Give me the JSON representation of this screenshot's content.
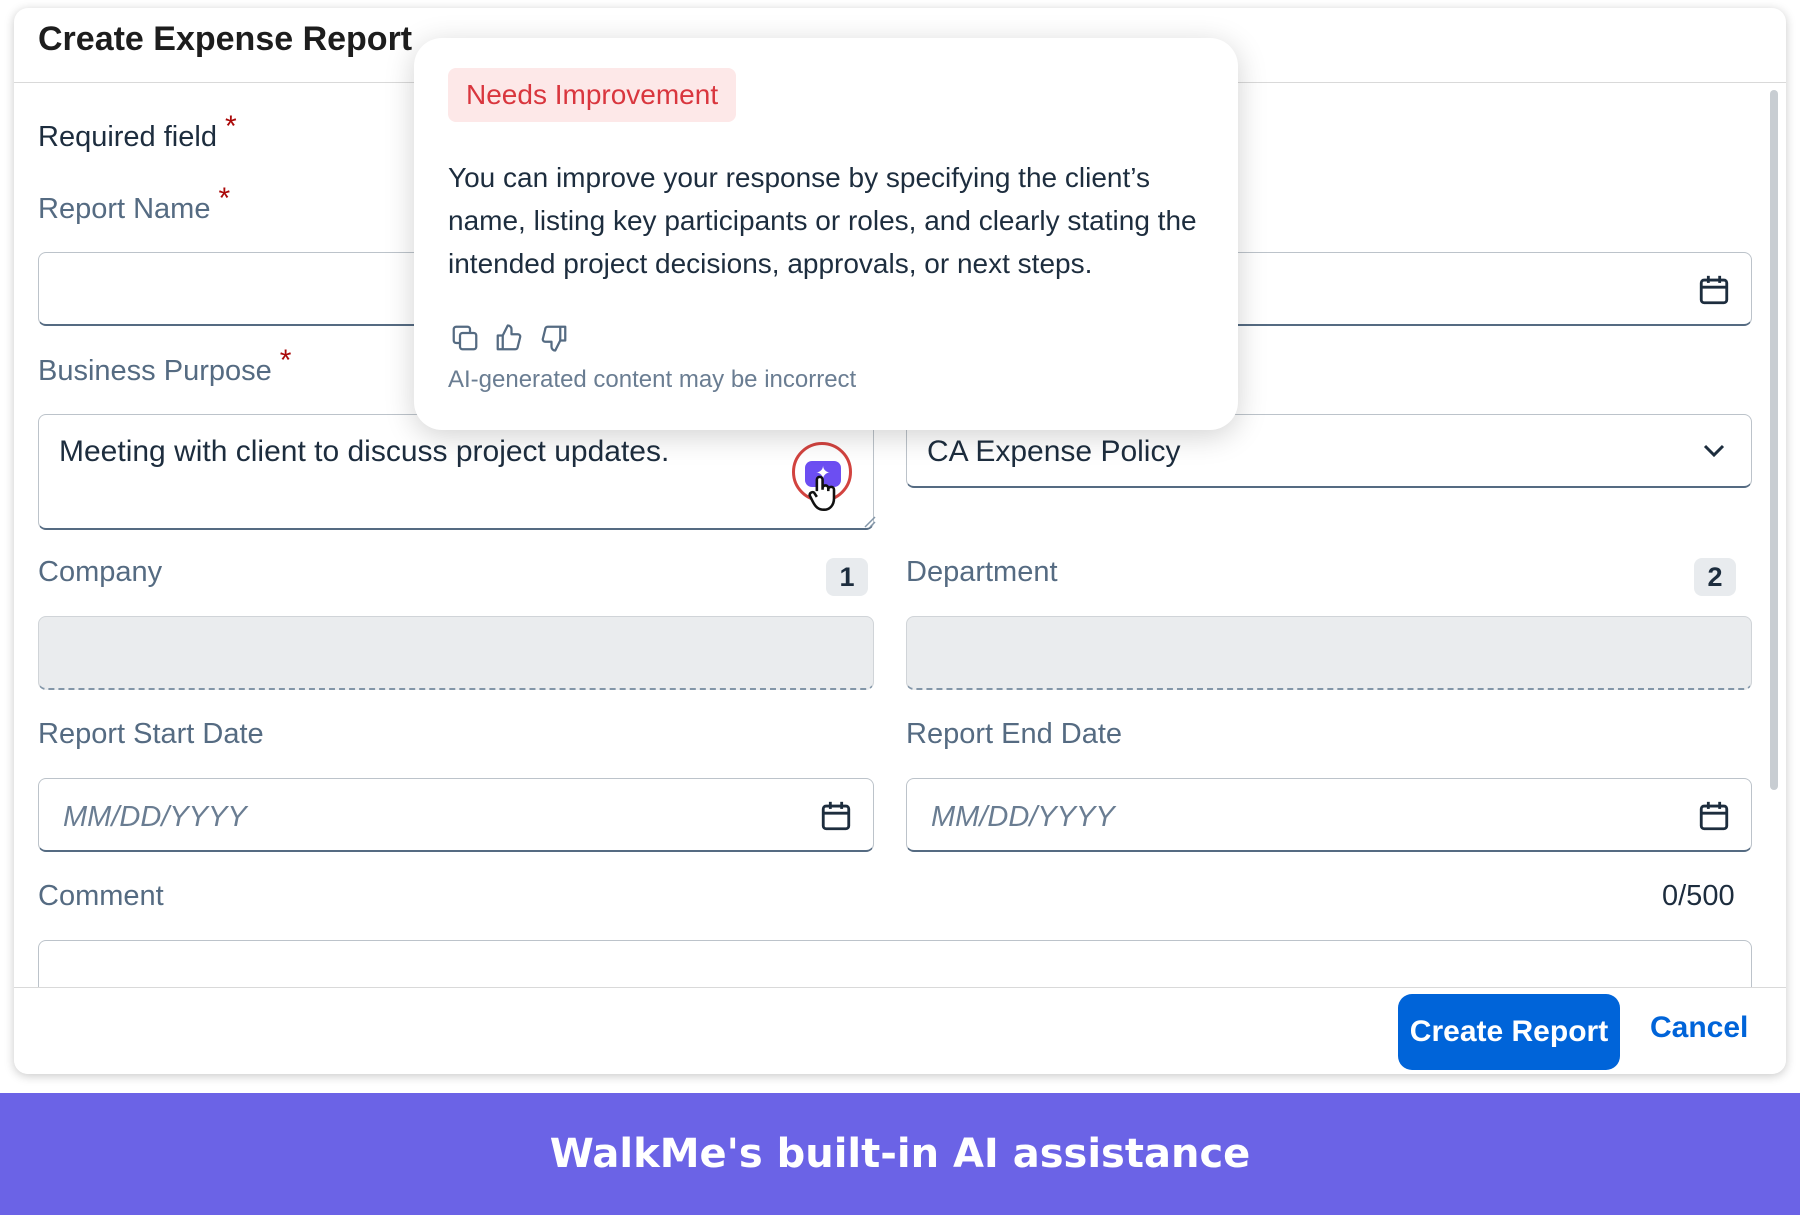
{
  "dialog": {
    "title": "Create Expense Report",
    "required_note": "Required field",
    "required_marker": "*"
  },
  "form": {
    "report_name": {
      "label": "Report Name",
      "value": ""
    },
    "business_purpose": {
      "label": "Business Purpose",
      "value": "Meeting with client to discuss project updates."
    },
    "policy": {
      "value": "CA Expense Policy"
    },
    "company": {
      "label": "Company",
      "badge": "1"
    },
    "department": {
      "label": "Department",
      "badge": "2"
    },
    "start_date": {
      "label": "Report Start Date",
      "placeholder": "MM/DD/YYYY"
    },
    "end_date": {
      "label": "Report End Date",
      "placeholder": "MM/DD/YYYY"
    },
    "comment": {
      "label": "Comment",
      "counter": "0/500"
    }
  },
  "footer": {
    "create_label": "Create Report",
    "cancel_label": "Cancel"
  },
  "ai_popover": {
    "rating": "Needs Improvement",
    "message": "You can improve your response by specifying the client’s name, listing key participants or roles, and clearly stating the intended project decisions, approvals, or next steps.",
    "disclaimer": "AI-generated content may be incorrect",
    "icons": [
      "copy-icon",
      "thumbs-up-icon",
      "thumbs-down-icon"
    ]
  },
  "banner": {
    "text": "WalkMe's built-in AI assistance"
  },
  "colors": {
    "primary": "#0064d9",
    "ai_accent": "#6c4ef2",
    "rating_text": "#d9363e",
    "rating_bg": "#fde8e8",
    "banner_bg": "#6b63e6",
    "required": "#aa0808"
  }
}
